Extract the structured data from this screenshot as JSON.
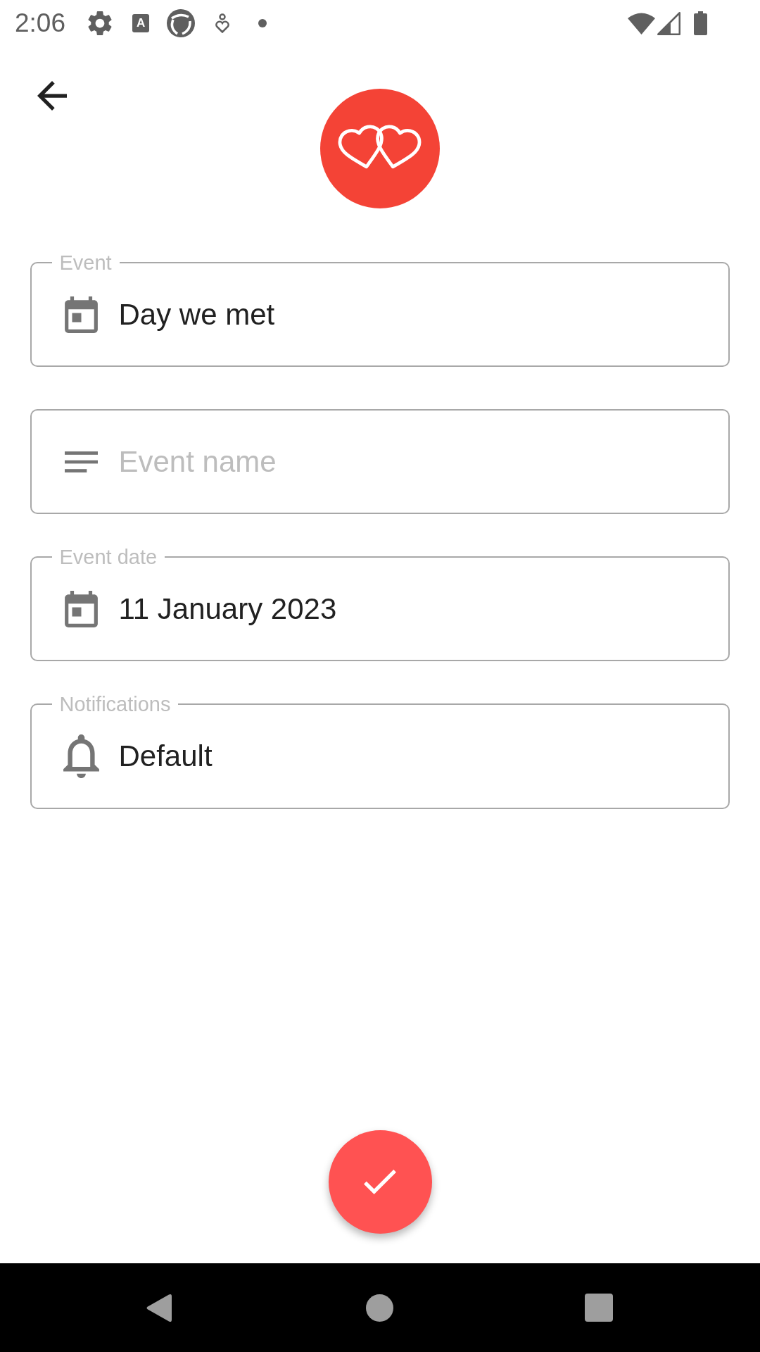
{
  "status_bar": {
    "time": "2:06",
    "app_letter": "A"
  },
  "form": {
    "fields": [
      {
        "kind": "event_type",
        "label": "Event",
        "value": "Day we met"
      },
      {
        "kind": "name",
        "placeholder": "Event name"
      },
      {
        "kind": "date",
        "label": "Event date",
        "value": "11 January 2023"
      },
      {
        "kind": "notifications",
        "label": "Notifications",
        "value": "Default"
      }
    ]
  }
}
